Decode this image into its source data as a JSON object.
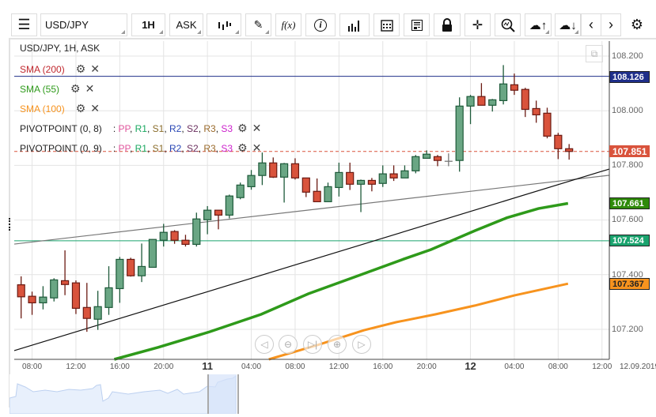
{
  "toolbar": {
    "symbol": "USD/JPY",
    "timeframe": "1H",
    "price_type": "ASK",
    "function_label": "f(x)"
  },
  "legend": {
    "title": "USD/JPY, 1H, ASK",
    "indicators": [
      {
        "label": "SMA (200)",
        "color": "#c0272d"
      },
      {
        "label": "SMA (55)",
        "color": "#2e9a1a"
      },
      {
        "label": "SMA (100)",
        "color": "#f7931e"
      }
    ],
    "pivots": [
      {
        "label": "PIVOTPOINT (0, 8)"
      },
      {
        "label": "PIVOTPOINT (0, 9)"
      }
    ],
    "pivot_keys": [
      {
        "k": "PP",
        "color": "#e0559c"
      },
      {
        "k": "R1",
        "color": "#1aa860"
      },
      {
        "k": "S1",
        "color": "#8a6d2b"
      },
      {
        "k": "R2",
        "color": "#2846b4"
      },
      {
        "k": "S2",
        "color": "#6b3060"
      },
      {
        "k": "R3",
        "color": "#9a6a2b"
      },
      {
        "k": "S3",
        "color": "#cc22cc"
      }
    ]
  },
  "price_axis": {
    "ticks": [
      "108.200",
      "108.000",
      "107.800",
      "107.600",
      "107.400",
      "107.200"
    ],
    "tags": {
      "resistance": {
        "value": "108.126",
        "color": "#1f2f8a"
      },
      "last": {
        "value": "107.851",
        "color": "#d9533c"
      },
      "sma55": {
        "value": "107.661",
        "color": "#2e8a0a"
      },
      "support": {
        "value": "107.524",
        "color": "#1aa36e"
      },
      "sma100": {
        "value": "107.367",
        "color": "#f7931e"
      }
    }
  },
  "time_axis": {
    "labels": [
      "08:00",
      "12:00",
      "16:00",
      "20:00",
      "11",
      "04:00",
      "08:00",
      "12:00",
      "16:00",
      "20:00",
      "12",
      "04:00",
      "08:00",
      "12:00"
    ],
    "date": "12.09.2019"
  },
  "chart_data": {
    "type": "candlestick",
    "symbol": "USD/JPY",
    "ylim": [
      107.1,
      108.25
    ],
    "candles": [
      [
        107.363,
        107.394,
        107.24,
        107.319
      ],
      [
        107.321,
        107.338,
        107.253,
        107.297
      ],
      [
        107.297,
        107.358,
        107.273,
        107.318
      ],
      [
        107.315,
        107.387,
        107.302,
        107.381
      ],
      [
        107.378,
        107.489,
        107.325,
        107.364
      ],
      [
        107.37,
        107.379,
        107.256,
        107.277
      ],
      [
        107.28,
        107.37,
        107.191,
        107.24
      ],
      [
        107.237,
        107.341,
        107.198,
        107.283
      ],
      [
        107.28,
        107.431,
        107.253,
        107.352
      ],
      [
        107.349,
        107.465,
        107.297,
        107.456
      ],
      [
        107.456,
        107.462,
        107.393,
        107.396
      ],
      [
        107.396,
        107.514,
        107.373,
        107.43
      ],
      [
        107.427,
        107.53,
        107.427,
        107.529
      ],
      [
        107.526,
        107.586,
        107.503,
        107.555
      ],
      [
        107.558,
        107.563,
        107.513,
        107.526
      ],
      [
        107.526,
        107.546,
        107.503,
        107.511
      ],
      [
        107.511,
        107.627,
        107.503,
        107.604
      ],
      [
        107.601,
        107.651,
        107.548,
        107.636
      ],
      [
        107.636,
        107.636,
        107.566,
        107.618
      ],
      [
        107.618,
        107.693,
        107.606,
        107.688
      ],
      [
        107.682,
        107.737,
        107.676,
        107.728
      ],
      [
        107.722,
        107.783,
        107.711,
        107.763
      ],
      [
        107.763,
        107.847,
        107.728,
        107.809
      ],
      [
        107.809,
        107.829,
        107.754,
        107.757
      ],
      [
        107.757,
        107.809,
        107.664,
        107.806
      ],
      [
        107.806,
        107.826,
        107.748,
        107.754
      ],
      [
        107.754,
        107.754,
        107.684,
        107.702
      ],
      [
        107.705,
        107.752,
        107.667,
        107.667
      ],
      [
        107.667,
        107.737,
        107.667,
        107.722
      ],
      [
        107.719,
        107.81,
        107.686,
        107.774
      ],
      [
        107.774,
        107.81,
        107.71,
        107.731
      ],
      [
        107.731,
        107.748,
        107.629,
        107.745
      ],
      [
        107.745,
        107.754,
        107.705,
        107.731
      ],
      [
        107.734,
        107.8,
        107.721,
        107.769
      ],
      [
        107.769,
        107.8,
        107.743,
        107.754
      ],
      [
        107.754,
        107.8,
        107.754,
        107.78
      ],
      [
        107.78,
        107.838,
        107.771,
        107.832
      ],
      [
        107.826,
        107.855,
        107.826,
        107.841
      ],
      [
        107.832,
        107.838,
        107.797,
        107.818
      ],
      [
        107.815,
        107.844,
        107.797,
        107.815
      ],
      [
        107.818,
        108.049,
        107.777,
        108.017
      ],
      [
        108.017,
        108.058,
        107.951,
        108.052
      ],
      [
        108.052,
        108.101,
        108.02,
        108.02
      ],
      [
        108.02,
        108.043,
        107.997,
        108.04
      ],
      [
        108.037,
        108.167,
        108.023,
        108.098
      ],
      [
        108.095,
        108.136,
        108.058,
        108.075
      ],
      [
        108.078,
        108.084,
        107.977,
        108.005
      ],
      [
        108.008,
        108.037,
        107.956,
        107.985
      ],
      [
        107.991,
        108.011,
        107.899,
        107.907
      ],
      [
        107.91,
        107.919,
        107.823,
        107.861
      ],
      [
        107.861,
        107.878,
        107.821,
        107.851
      ]
    ],
    "sma55": [
      [
        8.5,
        107.09
      ],
      [
        12.5,
        107.134
      ],
      [
        17.2,
        107.191
      ],
      [
        21.9,
        107.255
      ],
      [
        26.2,
        107.33
      ],
      [
        30.6,
        107.394
      ],
      [
        34.9,
        107.457
      ],
      [
        37.4,
        107.492
      ],
      [
        41.4,
        107.561
      ],
      [
        44.3,
        107.608
      ],
      [
        47.2,
        107.642
      ],
      [
        49.9,
        107.661
      ]
    ],
    "sma100": [
      [
        22.6,
        107.09
      ],
      [
        27.0,
        107.142
      ],
      [
        31.3,
        107.197
      ],
      [
        34.2,
        107.226
      ],
      [
        37.8,
        107.255
      ],
      [
        41.4,
        107.287
      ],
      [
        45.0,
        107.324
      ],
      [
        49.9,
        107.367
      ]
    ],
    "horizontal_lines": [
      108.126,
      107.524,
      107.851
    ],
    "trendlines": [
      {
        "from": [
          -0.63,
          107.512
        ],
        "to": [
          53.7,
          107.764
        ],
        "color": "#777"
      },
      {
        "from": [
          -0.63,
          107.122
        ],
        "to": [
          53.7,
          107.787
        ],
        "color": "#111"
      }
    ]
  }
}
